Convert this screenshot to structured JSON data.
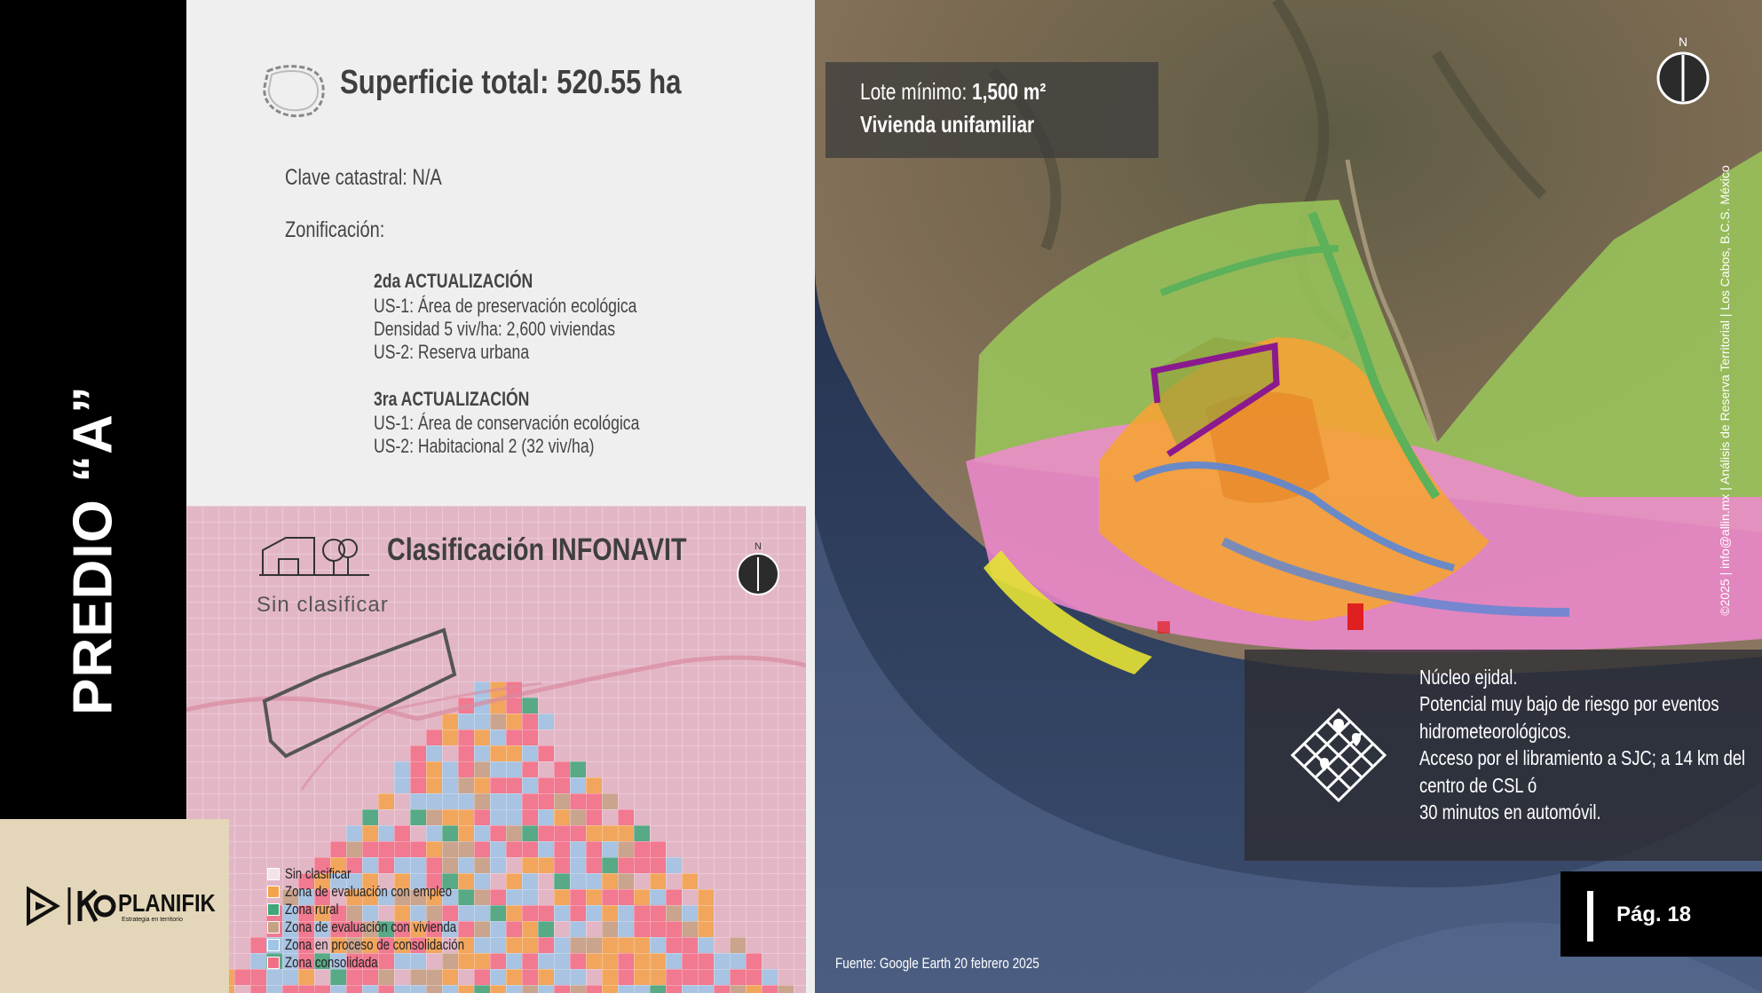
{
  "sidebar": {
    "title": "PREDIO “A”"
  },
  "info": {
    "superficie": "Superficie total: 520.55 ha",
    "clave": "Clave catastral: N/A",
    "zonificacion": "Zonificación:",
    "act2": {
      "heading": "2da ACTUALIZACIÓN",
      "lines": [
        "US-1: Área de preservación ecológica",
        "Densidad 5 viv/ha: 2,600 viviendas",
        "US-2: Reserva urbana"
      ]
    },
    "act3": {
      "heading": "3ra ACTUALIZACIÓN",
      "lines": [
        "US-1: Área de conservación ecológica",
        "US-2: Habitacional 2 (32 viv/ha)"
      ]
    }
  },
  "infonavit": {
    "title": "Clasificación INFONAVIT",
    "status": "Sin clasificar",
    "north": "N",
    "legend": [
      {
        "label": "Sin clasificar",
        "color": "#f3e4ea"
      },
      {
        "label": "Zona de evaluación con empleo",
        "color": "#f5a34a"
      },
      {
        "label": "Zona rural",
        "color": "#3fa77a"
      },
      {
        "label": "Zona de evaluación con vivienda",
        "color": "#c7a184"
      },
      {
        "label": "Zona en proceso de consolidación",
        "color": "#9fc6e6"
      },
      {
        "label": "Zona consolidada",
        "color": "#f36f86"
      }
    ]
  },
  "logo": {
    "name": "PLANIFIK",
    "tagline": "Estrategia en territorio"
  },
  "map": {
    "north": "N",
    "lote_prefix": "Lote mínimo: ",
    "lote_value": "1,500 m²",
    "vivienda": "Vivienda unifamiliar",
    "notes": [
      "Núcleo ejidal.",
      "Potencial muy bajo de riesgo por eventos",
      "hidrometeorológicos.",
      "Acceso por el libramiento a SJC; a 14 km del",
      "centro de CSL ó",
      "30 minutos en automóvil."
    ],
    "fuente": "Fuente: Google Earth 20 febrero 2025",
    "copyright": "©2025 | info@allin.mx | Análisis de Reserva Territorial | Los Cabos, B.C.S. México"
  },
  "page": {
    "label": "Pág. 18"
  },
  "colors": {
    "sidebar": "#000000",
    "panel": "#efefef",
    "accent_purple": "#8b1a8e",
    "logo_bg": "#e4d7b9"
  }
}
